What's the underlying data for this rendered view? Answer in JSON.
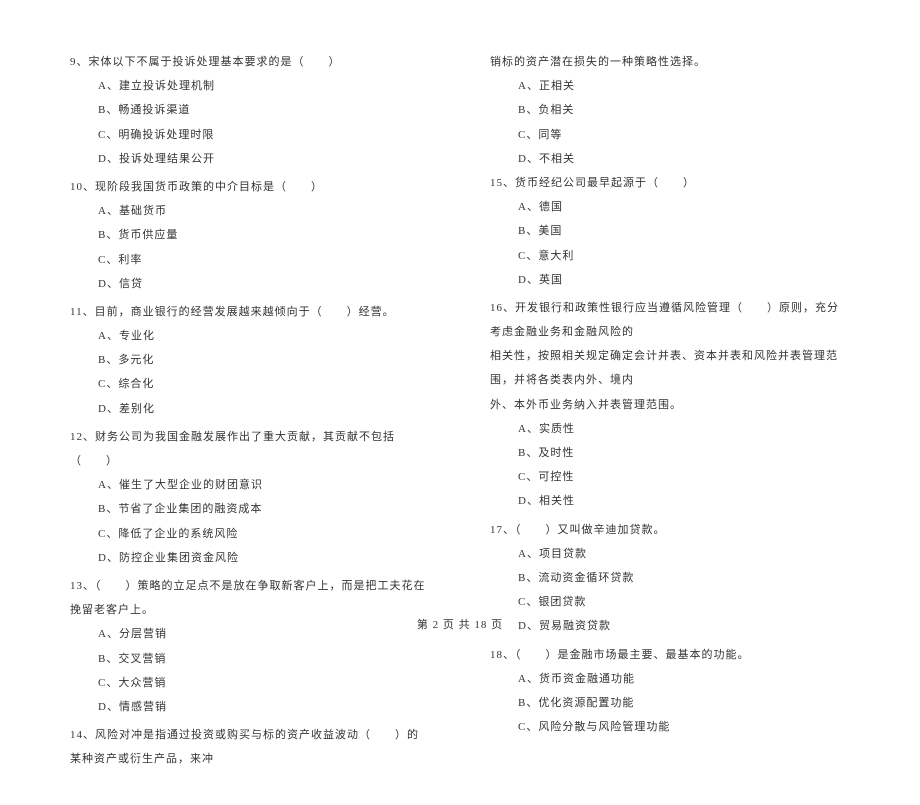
{
  "left_column": {
    "questions": [
      {
        "num": "9",
        "text": "宋体以下不属于投诉处理基本要求的是（　　）",
        "options": [
          {
            "letter": "A",
            "text": "建立投诉处理机制"
          },
          {
            "letter": "B",
            "text": "畅通投诉渠道"
          },
          {
            "letter": "C",
            "text": "明确投诉处理时限"
          },
          {
            "letter": "D",
            "text": "投诉处理结果公开"
          }
        ]
      },
      {
        "num": "10",
        "text": "现阶段我国货币政策的中介目标是（　　）",
        "options": [
          {
            "letter": "A",
            "text": "基础货币"
          },
          {
            "letter": "B",
            "text": "货币供应量"
          },
          {
            "letter": "C",
            "text": "利率"
          },
          {
            "letter": "D",
            "text": "信贷"
          }
        ]
      },
      {
        "num": "11",
        "text": "目前，商业银行的经营发展越来越倾向于（　　）经营。",
        "options": [
          {
            "letter": "A",
            "text": "专业化"
          },
          {
            "letter": "B",
            "text": "多元化"
          },
          {
            "letter": "C",
            "text": "综合化"
          },
          {
            "letter": "D",
            "text": "差别化"
          }
        ]
      },
      {
        "num": "12",
        "text": "财务公司为我国金融发展作出了重大贡献，其贡献不包括（　　）",
        "options": [
          {
            "letter": "A",
            "text": "催生了大型企业的财团意识"
          },
          {
            "letter": "B",
            "text": "节省了企业集团的融资成本"
          },
          {
            "letter": "C",
            "text": "降低了企业的系统风险"
          },
          {
            "letter": "D",
            "text": "防控企业集团资金风险"
          }
        ]
      },
      {
        "num": "13",
        "text": "（　　）策略的立足点不是放在争取新客户上，而是把工夫花在挽留老客户上。",
        "options": [
          {
            "letter": "A",
            "text": "分层营销"
          },
          {
            "letter": "B",
            "text": "交叉营销"
          },
          {
            "letter": "C",
            "text": "大众营销"
          },
          {
            "letter": "D",
            "text": "情感营销"
          }
        ]
      },
      {
        "num": "14",
        "text": "风险对冲是指通过投资或购买与标的资产收益波动（　　）的某种资产或衍生产品，来冲",
        "options": []
      }
    ]
  },
  "right_column": {
    "continuation": "销标的资产潜在损失的一种策略性选择。",
    "continuation_options": [
      {
        "letter": "A",
        "text": "正相关"
      },
      {
        "letter": "B",
        "text": "负相关"
      },
      {
        "letter": "C",
        "text": "同等"
      },
      {
        "letter": "D",
        "text": "不相关"
      }
    ],
    "questions": [
      {
        "num": "15",
        "text": "货币经纪公司最早起源于（　　）",
        "options": [
          {
            "letter": "A",
            "text": "德国"
          },
          {
            "letter": "B",
            "text": "美国"
          },
          {
            "letter": "C",
            "text": "意大利"
          },
          {
            "letter": "D",
            "text": "英国"
          }
        ]
      },
      {
        "num": "16",
        "text_lines": [
          "开发银行和政策性银行应当遵循风险管理（　　）原则，充分考虑金融业务和金融风险的",
          "相关性，按照相关规定确定会计并表、资本并表和风险并表管理范围，并将各类表内外、境内",
          "外、本外币业务纳入并表管理范围。"
        ],
        "options": [
          {
            "letter": "A",
            "text": "实质性"
          },
          {
            "letter": "B",
            "text": "及时性"
          },
          {
            "letter": "C",
            "text": "可控性"
          },
          {
            "letter": "D",
            "text": "相关性"
          }
        ]
      },
      {
        "num": "17",
        "text": "（　　）又叫做辛迪加贷款。",
        "options": [
          {
            "letter": "A",
            "text": "项目贷款"
          },
          {
            "letter": "B",
            "text": "流动资金循环贷款"
          },
          {
            "letter": "C",
            "text": "银团贷款"
          },
          {
            "letter": "D",
            "text": "贸易融资贷款"
          }
        ]
      },
      {
        "num": "18",
        "text": "（　　）是金融市场最主要、最基本的功能。",
        "options": [
          {
            "letter": "A",
            "text": "货币资金融通功能"
          },
          {
            "letter": "B",
            "text": "优化资源配置功能"
          },
          {
            "letter": "C",
            "text": "风险分散与风险管理功能"
          }
        ]
      }
    ]
  },
  "footer": "第 2 页 共 18 页"
}
